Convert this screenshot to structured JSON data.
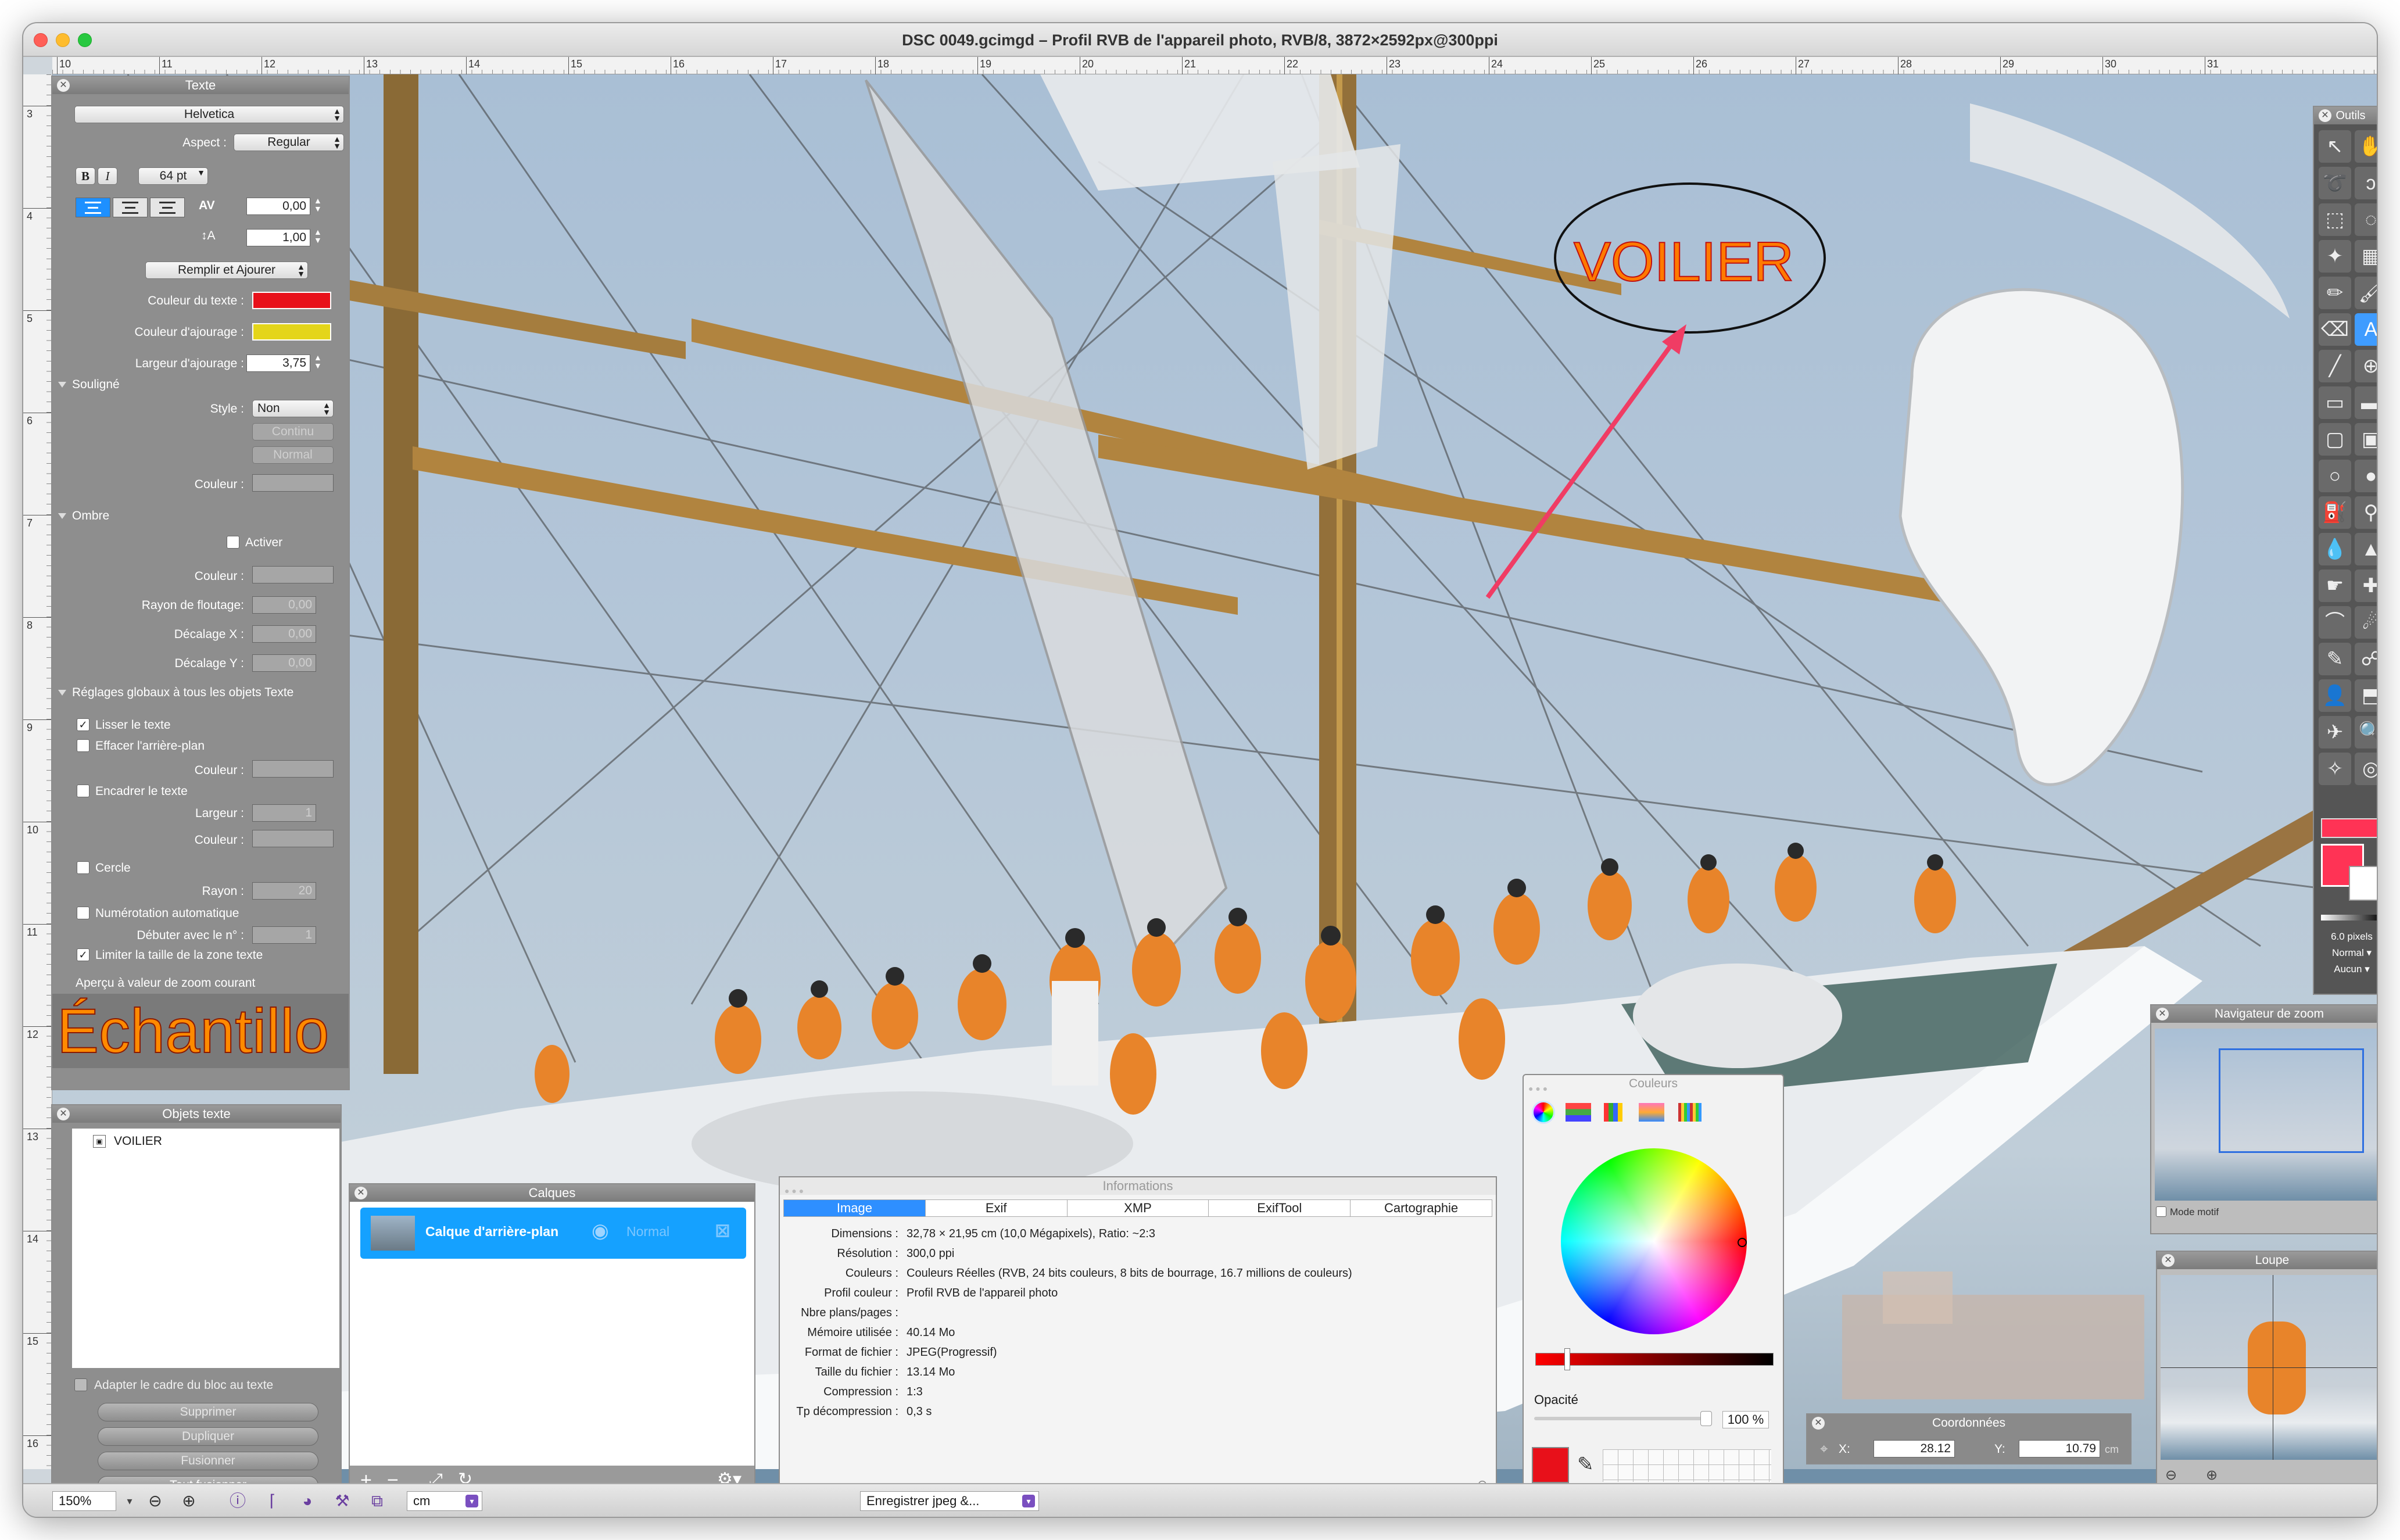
{
  "window": {
    "title": "DSC 0049.gcimgd – Profil RVB de l'appareil photo, RVB/8, 3872×2592px@300ppi"
  },
  "rulers": {
    "top": [
      "10",
      "11",
      "12",
      "13",
      "14",
      "15",
      "16",
      "17",
      "18",
      "19",
      "20",
      "21",
      "22",
      "23",
      "24",
      "25",
      "26",
      "27",
      "28",
      "29",
      "30",
      "31"
    ],
    "left": [
      "3",
      "4",
      "5",
      "6",
      "7",
      "8",
      "9",
      "10",
      "11",
      "12",
      "13",
      "14",
      "15",
      "16"
    ]
  },
  "canvas": {
    "annotation_text": "VOILIER"
  },
  "texte_panel": {
    "title": "Texte",
    "font": "Helvetica",
    "aspect_label": "Aspect :",
    "aspect_value": "Regular",
    "bold": "B",
    "italic": "I",
    "size": "64 pt",
    "kerning": "0,00",
    "leading": "1,00",
    "mode": "Remplir et Ajourer",
    "text_color_label": "Couleur du texte :",
    "stroke_color_label": "Couleur d'ajourage :",
    "stroke_width_label": "Largeur d'ajourage :",
    "stroke_width": "3,75",
    "underline_section": "Souligné",
    "style_label": "Style :",
    "style_value": "Non",
    "continu": "Continu",
    "normal": "Normal",
    "underline_color_label": "Couleur :",
    "shadow_section": "Ombre",
    "activate": "Activer",
    "shadow_color_label": "Couleur :",
    "blur_label": "Rayon de floutage:",
    "blur_value": "0,00",
    "offset_x_label": "Décalage X :",
    "offset_x": "0,00",
    "offset_y_label": "Décalage Y :",
    "offset_y": "0,00",
    "global_section": "Réglages globaux à tous les objets Texte",
    "smooth": "Lisser le texte",
    "erase_bg": "Effacer l'arrière-plan",
    "erase_color_label": "Couleur :",
    "frame": "Encadrer le texte",
    "frame_width_label": "Largeur :",
    "frame_width": "1",
    "frame_color_label": "Couleur :",
    "circle": "Cercle",
    "radius_label": "Rayon :",
    "radius": "20",
    "autonum": "Numérotation automatique",
    "start_label": "Débuter avec le n° :",
    "start_value": "1",
    "limit": "Limiter la taille de la zone texte",
    "preview_label": "Aperçu à valeur de zoom courant",
    "sample": "Échantillo"
  },
  "objets_panel": {
    "title": "Objets texte",
    "items": [
      "VOILIER"
    ],
    "fit": "Adapter le cadre du bloc au texte",
    "delete": "Supprimer",
    "duplicate": "Dupliquer",
    "merge": "Fusionner",
    "merge_all": "Tout fusionner"
  },
  "calques_panel": {
    "title": "Calques",
    "layer_name": "Calque d'arrière-plan",
    "blend": "Normal"
  },
  "info_panel": {
    "title": "Informations",
    "tabs": [
      "Image",
      "Exif",
      "XMP",
      "ExifTool",
      "Cartographie"
    ],
    "rows": [
      {
        "k": "Dimensions :",
        "v": "32,78 × 21,95 cm (10,0 Mégapixels), Ratio: ~2:3"
      },
      {
        "k": "Résolution :",
        "v": "300,0 ppi"
      },
      {
        "k": "Couleurs :",
        "v": "Couleurs Réelles (RVB, 24 bits couleurs, 8 bits de bourrage, 16.7 millions de couleurs)"
      },
      {
        "k": "Profil couleur :",
        "v": "Profil RVB de l'appareil photo"
      },
      {
        "k": "Nbre plans/pages :",
        "v": ""
      },
      {
        "k": "Mémoire utilisée :",
        "v": "40.14  Mo"
      },
      {
        "k": "Format de fichier :",
        "v": "JPEG(Progressif)"
      },
      {
        "k": "Taille du fichier :",
        "v": "13.14  Mo"
      },
      {
        "k": "Compression :",
        "v": "1:3"
      },
      {
        "k": "Tp décompression :",
        "v": "0,3 s"
      }
    ]
  },
  "couleurs_panel": {
    "title": "Couleurs",
    "opacity_label": "Opacité",
    "opacity_value": "100 %"
  },
  "outils_panel": {
    "title": "Outils",
    "brush_size": "6.0 pixels",
    "mode": "Normal",
    "pattern": "Aucun"
  },
  "nav_panel": {
    "title": "Navigateur de zoom",
    "mode_motif": "Mode motif"
  },
  "loupe_panel": {
    "title": "Loupe"
  },
  "coord_panel": {
    "title": "Coordonnées",
    "x_label": "X:",
    "x": "28.12",
    "y_label": "Y:",
    "y": "10.79",
    "unit": "cm"
  },
  "statusbar": {
    "zoom": "150%",
    "unit": "cm",
    "save": "Enregistrer jpeg &..."
  },
  "colors": {
    "text": "#e8101a",
    "stroke": "#e4d51a",
    "accent": "#1e90ff",
    "arrow": "#f03c64"
  }
}
